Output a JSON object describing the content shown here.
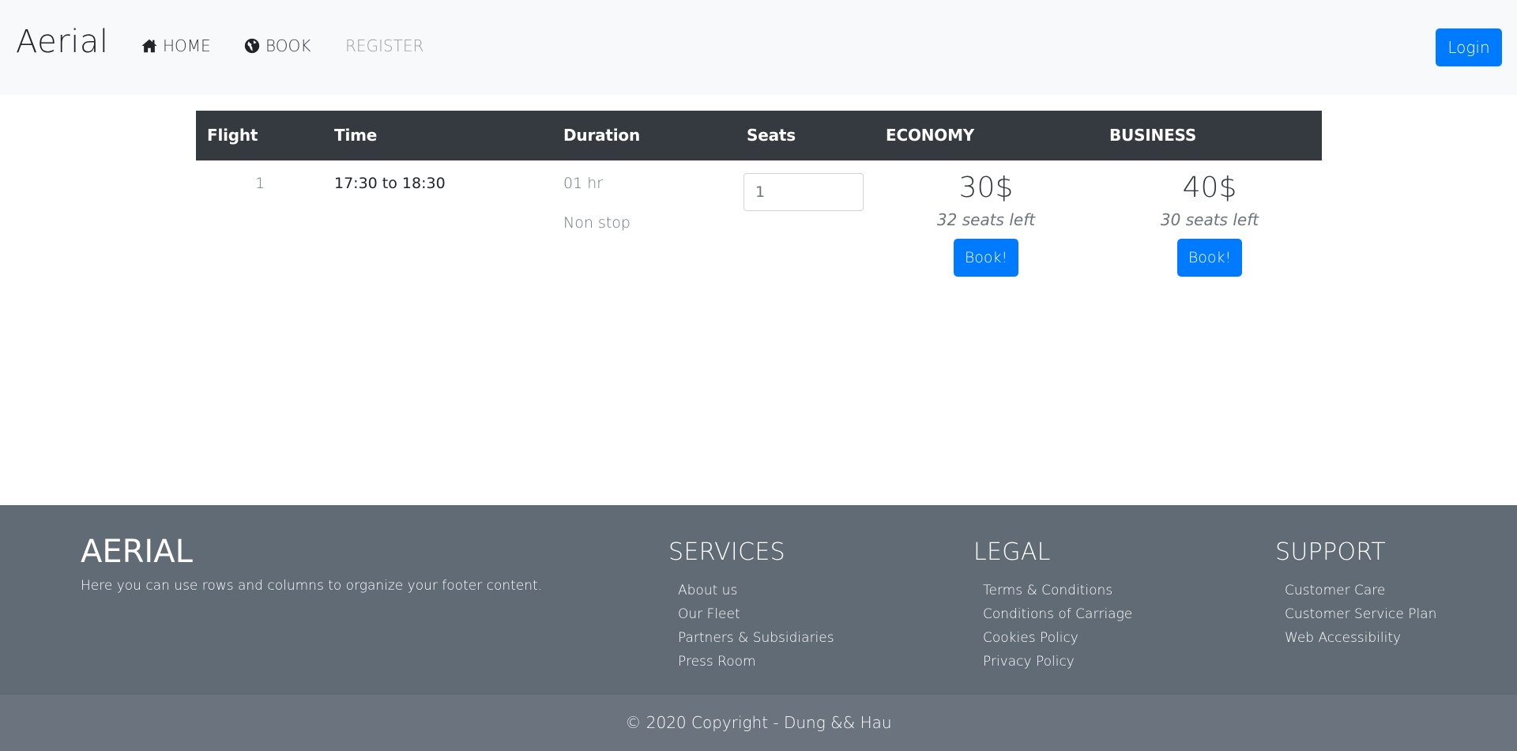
{
  "navbar": {
    "brand": "Aerial",
    "items": [
      {
        "label": "HOME",
        "icon": "home-icon"
      },
      {
        "label": "BOOK",
        "icon": "globe-icon"
      },
      {
        "label": "REGISTER",
        "icon": ""
      }
    ],
    "login_label": "Login"
  },
  "table": {
    "headers": [
      "Flight",
      "Time",
      "Duration",
      "Seats",
      "ECONOMY",
      "BUSINESS"
    ],
    "rows": [
      {
        "flight": "1",
        "time": "17:30 to 18:30",
        "duration": "01 hr",
        "stops": "Non stop",
        "seats_value": "1",
        "economy": {
          "price": "30$",
          "left": "32 seats left",
          "button": "Book!"
        },
        "business": {
          "price": "40$",
          "left": "30 seats left",
          "button": "Book!"
        }
      }
    ]
  },
  "footer": {
    "brand": "AERIAL",
    "description": "Here you can use rows and columns to organize your footer content.",
    "columns": [
      {
        "title": "SERVICES",
        "links": [
          "About us",
          "Our Fleet",
          "Partners & Subsidiaries",
          "Press Room"
        ]
      },
      {
        "title": "LEGAL",
        "links": [
          "Terms & Conditions",
          "Conditions of Carriage",
          "Cookies Policy",
          "Privacy Policy"
        ]
      },
      {
        "title": "SUPPORT",
        "links": [
          "Customer Care",
          "Customer Service Plan",
          "Web Accessibility"
        ]
      }
    ],
    "copyright": "© 2020 Copyright - Dung && Hau"
  },
  "colors": {
    "primary": "#007bff",
    "navbar_bg": "#f8f9fa",
    "table_header_bg": "#343a40",
    "footer_bg": "#616b75",
    "copyright_bg": "#6b747e"
  }
}
